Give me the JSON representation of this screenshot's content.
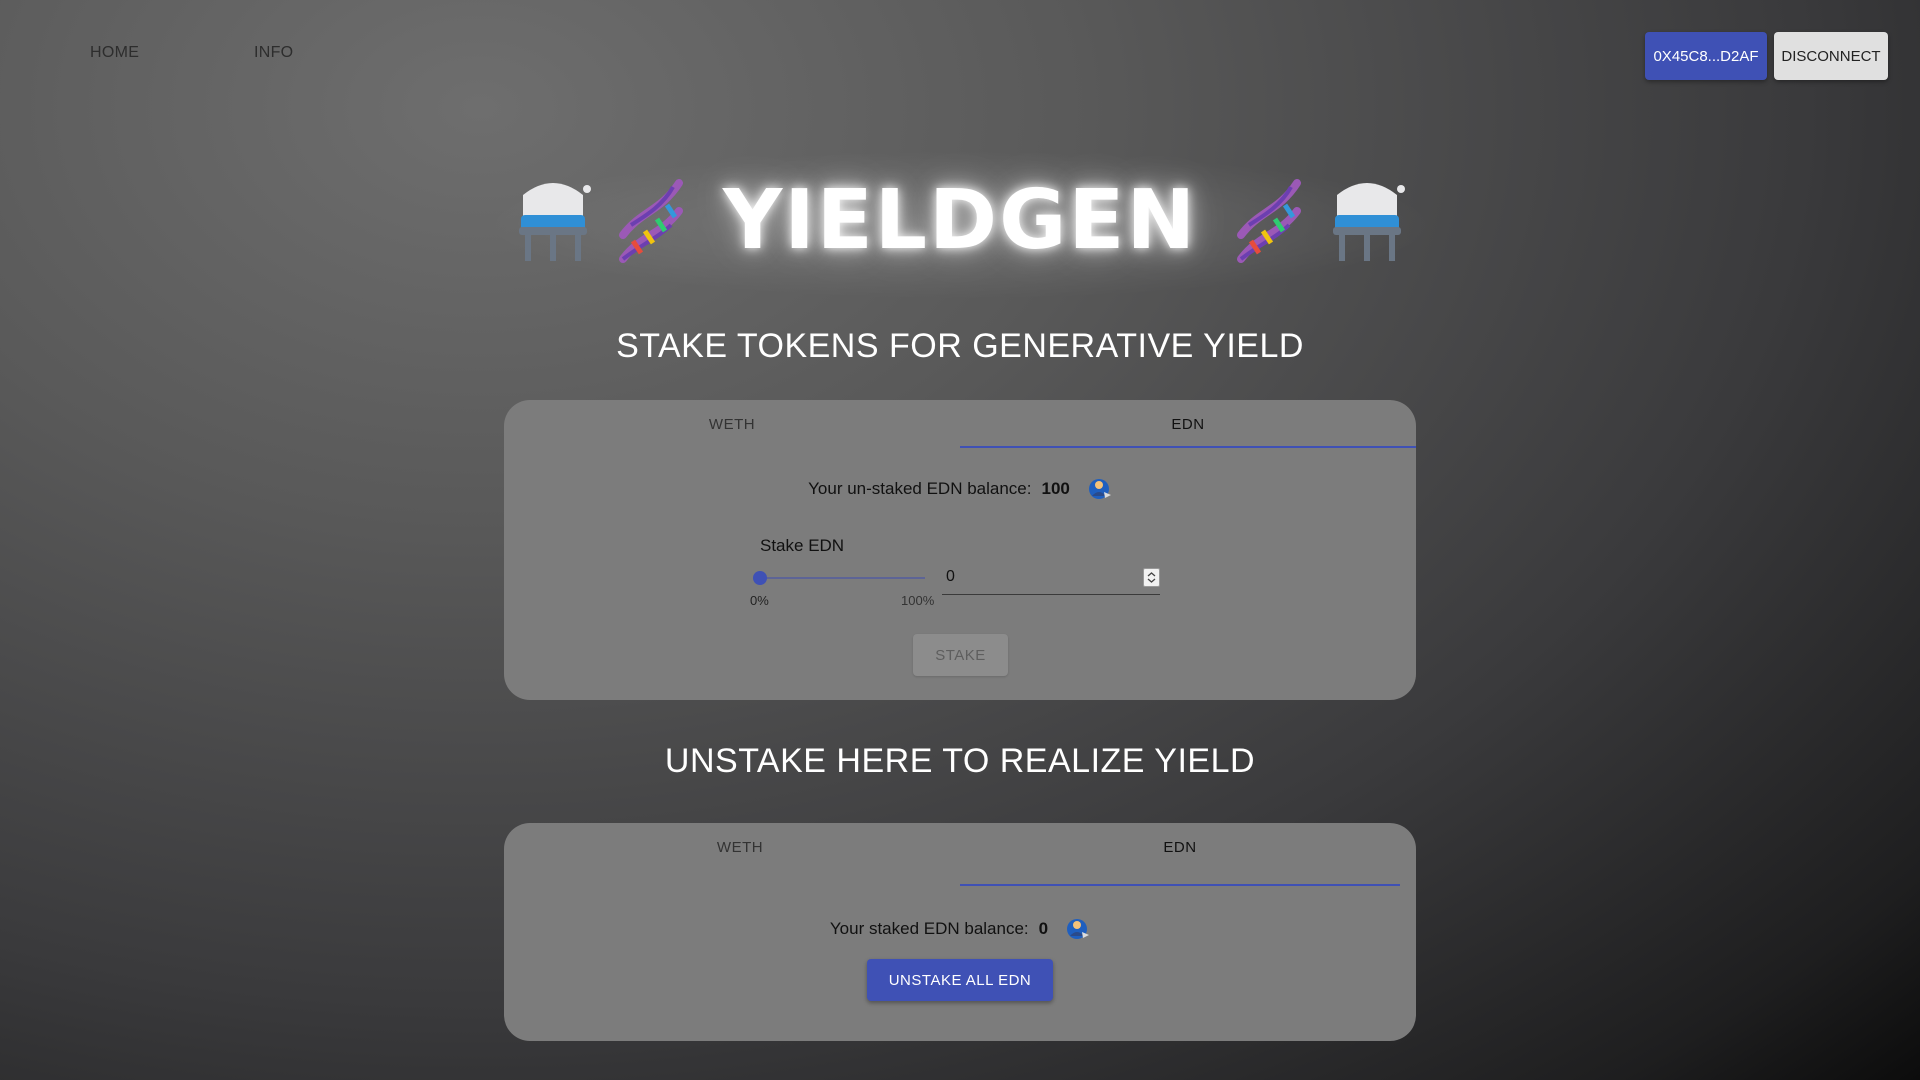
{
  "nav": {
    "home": "HOME",
    "info": "INFO"
  },
  "wallet": {
    "address": "0X45C8...D2AF",
    "disconnect": "DISCONNECT"
  },
  "logo": {
    "title": "YIELDGEN"
  },
  "stake_section": {
    "heading": "STAKE TOKENS FOR GENERATIVE YIELD",
    "tabs": [
      "WETH",
      "EDN"
    ],
    "active_tab": "EDN",
    "balance_label": "Your un-staked EDN balance:",
    "balance_value": "100",
    "stake_label": "Stake EDN",
    "slider_min": "0%",
    "slider_max": "100%",
    "slider_value_percent": 0,
    "amount_value": "0",
    "button": "STAKE"
  },
  "unstake_section": {
    "heading": "UNSTAKE HERE TO REALIZE YIELD",
    "tabs": [
      "WETH",
      "EDN"
    ],
    "active_tab": "EDN",
    "balance_label": "Your staked EDN balance:",
    "balance_value": "0",
    "button": "UNSTAKE ALL EDN"
  },
  "colors": {
    "accent": "#3f51b5",
    "card": "#7c7c7c",
    "disconnect_bg": "#e0e0e0"
  },
  "icons": [
    "flask-icon",
    "dna-icon",
    "coin-icon"
  ]
}
